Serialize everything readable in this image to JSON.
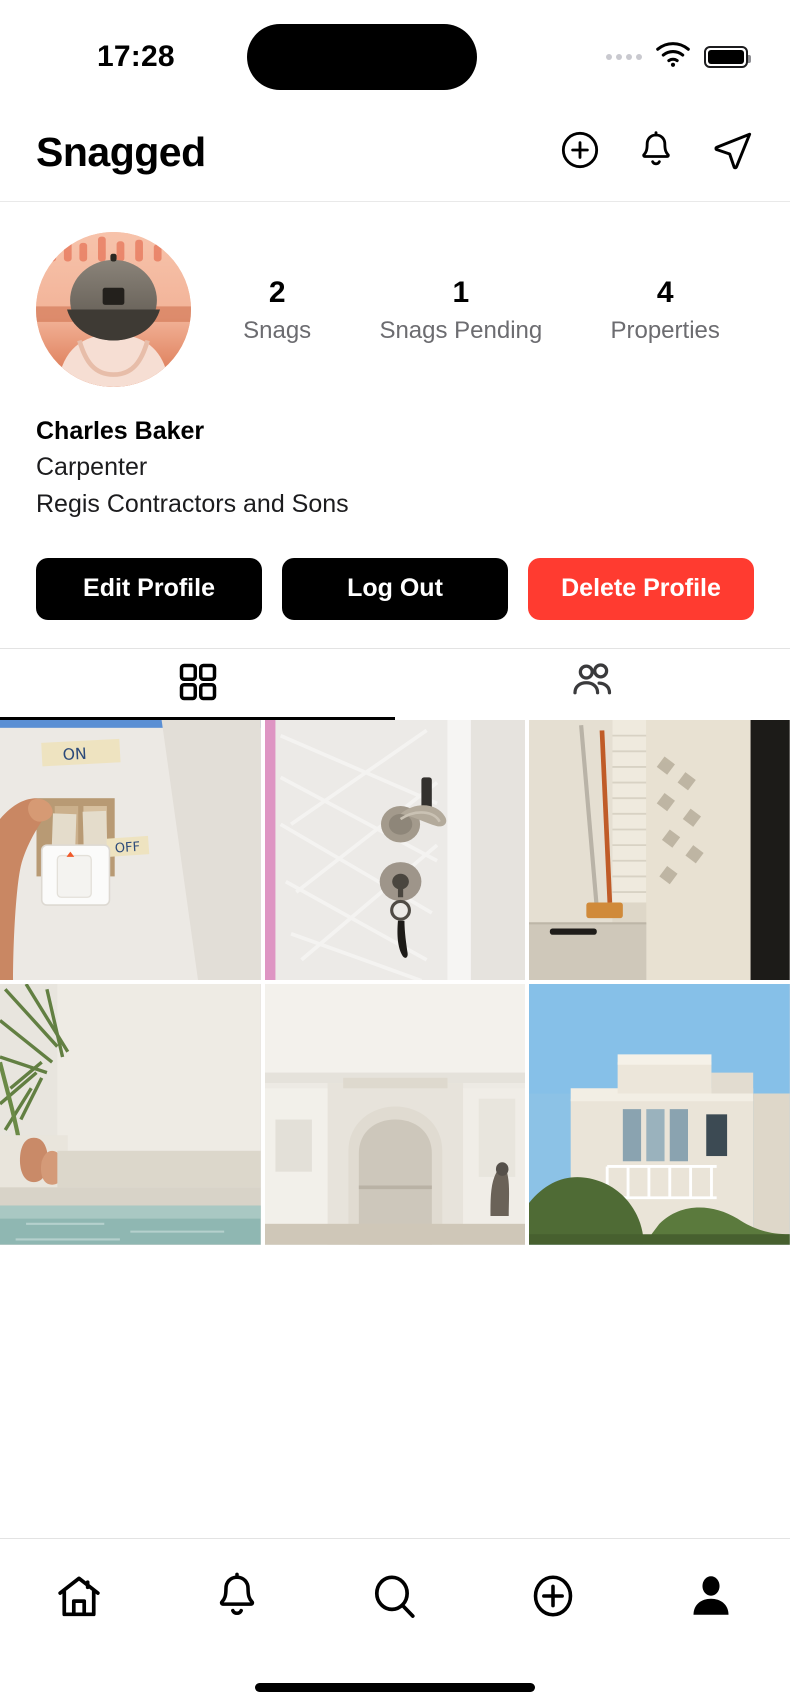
{
  "status_bar": {
    "time": "17:28",
    "signal_icon": "signal-dots-icon",
    "wifi_icon": "wifi-icon",
    "battery_icon": "battery-icon"
  },
  "header": {
    "title": "Snagged",
    "actions": [
      {
        "name": "add-circle-icon",
        "label": "Add"
      },
      {
        "name": "bell-icon",
        "label": "Notifications"
      },
      {
        "name": "send-icon",
        "label": "Messages"
      }
    ]
  },
  "profile": {
    "avatar_alt": "Profile photo of person wearing a cap",
    "stats": [
      {
        "value": "2",
        "label": "Snags"
      },
      {
        "value": "1",
        "label": "Snags Pending"
      },
      {
        "value": "4",
        "label": "Properties"
      }
    ],
    "name": "Charles Baker",
    "role": "Carpenter",
    "company": "Regis Contractors and Sons",
    "buttons": [
      {
        "label": "Edit Profile",
        "style": "dark"
      },
      {
        "label": "Log Out",
        "style": "dark"
      },
      {
        "label": "Delete Profile",
        "style": "danger"
      }
    ]
  },
  "tabs": [
    {
      "name": "tab-grid",
      "icon": "grid-icon",
      "active": true
    },
    {
      "name": "tab-tagged",
      "icon": "people-icon",
      "active": false
    }
  ],
  "gallery": [
    {
      "id": 1,
      "alt": "Light switch with ON, LIGHTS, FAN and OFF labels taped to wall"
    },
    {
      "id": 2,
      "alt": "White door with handle, lock and keys, covered in plastic wrap"
    },
    {
      "id": 3,
      "alt": "Broom and mop leaning against beige exterior wall"
    },
    {
      "id": 4,
      "alt": "Pool corner with palm plant and terracotta pots"
    },
    {
      "id": 5,
      "alt": "Arched alcove niche recess built into white wall"
    },
    {
      "id": 6,
      "alt": "Exterior of white modern villa with balcony and blue sky"
    }
  ],
  "bottom_nav": [
    {
      "name": "nav-home",
      "icon": "home-icon",
      "active": false
    },
    {
      "name": "nav-notifications",
      "icon": "bell-icon",
      "active": false
    },
    {
      "name": "nav-search",
      "icon": "search-icon",
      "active": false
    },
    {
      "name": "nav-create",
      "icon": "add-circle-icon",
      "active": false
    },
    {
      "name": "nav-profile",
      "icon": "person-icon",
      "active": true
    }
  ],
  "colors": {
    "danger": "#FF3B30",
    "dark": "#000000",
    "muted": "#6C6C70",
    "divider": "#E3E3E3"
  }
}
